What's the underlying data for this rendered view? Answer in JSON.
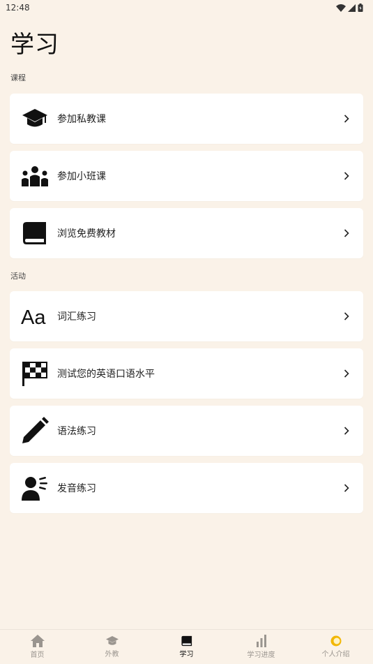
{
  "status_bar": {
    "time": "12:48"
  },
  "page": {
    "title": "学习"
  },
  "sections": {
    "courses": {
      "label": "课程"
    },
    "activities": {
      "label": "活动"
    }
  },
  "items": [
    {
      "label": "参加私教课",
      "icon": "graduation-cap-icon"
    },
    {
      "label": "参加小班课",
      "icon": "group-icon"
    },
    {
      "label": "浏览免费教材",
      "icon": "book-icon"
    },
    {
      "label": "词汇练习",
      "icon": "text-aa-icon"
    },
    {
      "label": "测试您的英语口语水平",
      "icon": "checkered-flag-icon"
    },
    {
      "label": "语法练习",
      "icon": "pencil-icon"
    },
    {
      "label": "发音练习",
      "icon": "speaking-person-icon"
    }
  ],
  "bottom_nav": [
    {
      "label": "首页",
      "icon": "home-icon"
    },
    {
      "label": "外教",
      "icon": "graduation-cap-icon"
    },
    {
      "label": "学习",
      "icon": "book-icon",
      "active": true
    },
    {
      "label": "学习进度",
      "icon": "bar-chart-icon"
    },
    {
      "label": "个人介绍",
      "icon": "profile-icon"
    }
  ],
  "colors": {
    "background": "#faf2e8",
    "card": "#ffffff",
    "nav_inactive": "#9a958f",
    "nav_active": "#111111",
    "profile_accent": "#f2b705"
  }
}
